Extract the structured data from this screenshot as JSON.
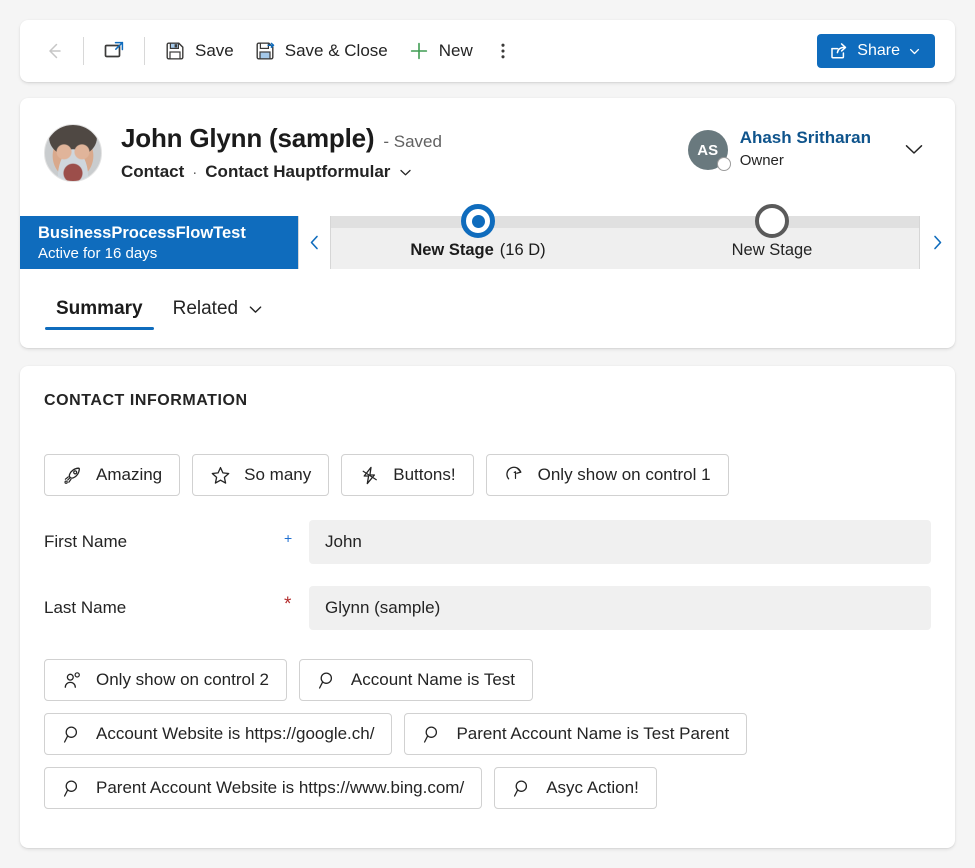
{
  "command_bar": {
    "back_label": "Back",
    "popout_label": "Open in new window",
    "save_label": "Save",
    "save_close_label": "Save & Close",
    "new_label": "New",
    "overflow_label": "More commands",
    "share_label": "Share",
    "share_color": "#0f6cbd"
  },
  "record": {
    "title": "John Glynn (sample)",
    "saved_status": "- Saved",
    "entity": "Contact",
    "separator": "·",
    "form_name": "Contact Hauptformular",
    "avatar_alt": "John Glynn photo"
  },
  "owner": {
    "initials": "AS",
    "name": "Ahash Sritharan",
    "role": "Owner",
    "name_color": "#0f548c",
    "avatar_color": "#69797e"
  },
  "business_process_flow": {
    "process_name": "BusinessProcessFlowTest",
    "active_text": "Active for 16 days",
    "tile_color": "#0f6cbd",
    "prev_label": "Previous stage",
    "next_label": "Next stage",
    "stages": [
      {
        "label": "New Stage",
        "duration": "(16 D)",
        "state": "active"
      },
      {
        "label": "New Stage",
        "duration": "",
        "state": "inactive"
      }
    ]
  },
  "tabs": [
    {
      "label": "Summary",
      "active": true,
      "has_chevron": false
    },
    {
      "label": "Related",
      "active": false,
      "has_chevron": true
    }
  ],
  "form": {
    "section_header": "CONTACT INFORMATION",
    "button_rows": [
      [
        {
          "label": "Amazing",
          "icon": "rocket-icon"
        },
        {
          "label": "So many",
          "icon": "star-icon"
        },
        {
          "label": "Buttons!",
          "icon": "lightning-icon"
        },
        {
          "label": "Only show on control 1",
          "icon": "refresh-circle-1-icon"
        }
      ],
      [
        {
          "label": "Only show on control 2",
          "icon": "person-icon"
        },
        {
          "label": "Account Name is Test",
          "icon": "search-icon"
        }
      ],
      [
        {
          "label": "Account Website is https://google.ch/",
          "icon": "search-icon"
        },
        {
          "label": "Parent Account Name is Test Parent",
          "icon": "search-icon"
        }
      ],
      [
        {
          "label": "Parent Account Website is https://www.bing.com/",
          "icon": "search-icon"
        },
        {
          "label": "Asyc Action!",
          "icon": "search-icon"
        }
      ]
    ],
    "fields": [
      {
        "label": "First Name",
        "value": "John",
        "requirement": "recommended",
        "marker": "+"
      },
      {
        "label": "Last Name",
        "value": "Glynn (sample)",
        "requirement": "required",
        "marker": "*"
      }
    ]
  }
}
